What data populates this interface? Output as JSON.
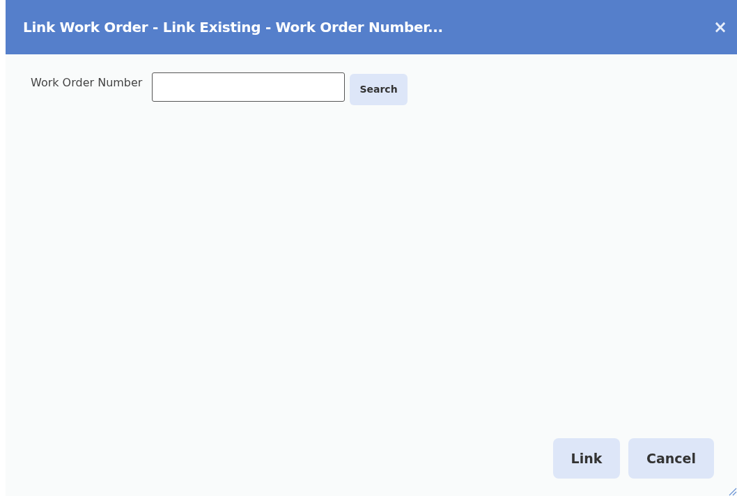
{
  "window": {
    "title": "Link Work Order - Link Existing - Work Order Number...",
    "close": "×"
  },
  "search": {
    "label": "Work Order Number",
    "button": "Search"
  },
  "buttons": [
    "Link",
    "Cancel"
  ]
}
